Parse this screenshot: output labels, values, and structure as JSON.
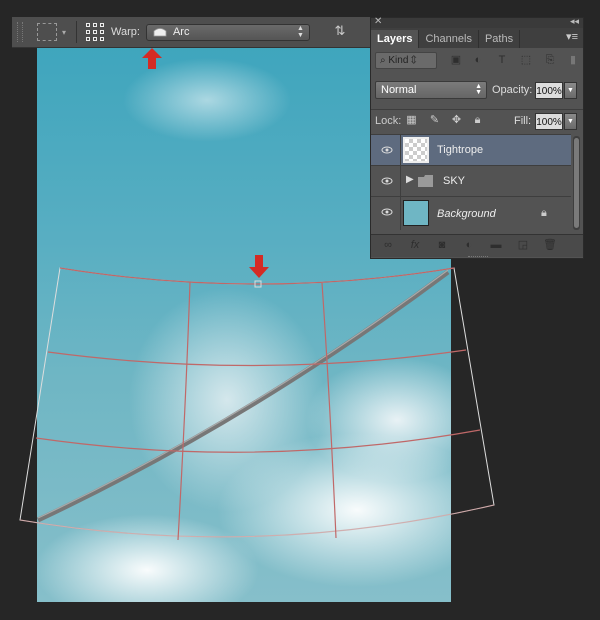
{
  "options_bar": {
    "warp_label": "Warp:",
    "warp_value": "Arc",
    "orientation_icon": "warp-orientation-icon"
  },
  "layers_panel": {
    "tabs": [
      {
        "label": "Layers",
        "active": true
      },
      {
        "label": "Channels",
        "active": false
      },
      {
        "label": "Paths",
        "active": false
      }
    ],
    "filter": {
      "placeholder": "Kind"
    },
    "blend_mode": "Normal",
    "opacity_label": "Opacity:",
    "opacity_value": "100%",
    "lock_label": "Lock:",
    "fill_label": "Fill:",
    "fill_value": "100%",
    "layers": [
      {
        "name": "Tightrope",
        "selected": true
      },
      {
        "name": "SKY",
        "type": "group"
      },
      {
        "name": "Background",
        "locked": true
      }
    ]
  },
  "colors": {
    "panel_bg": "#535353",
    "selected_layer": "#5e6b7f",
    "annotation_arrow": "#d42b25",
    "app_bg": "#262626"
  }
}
